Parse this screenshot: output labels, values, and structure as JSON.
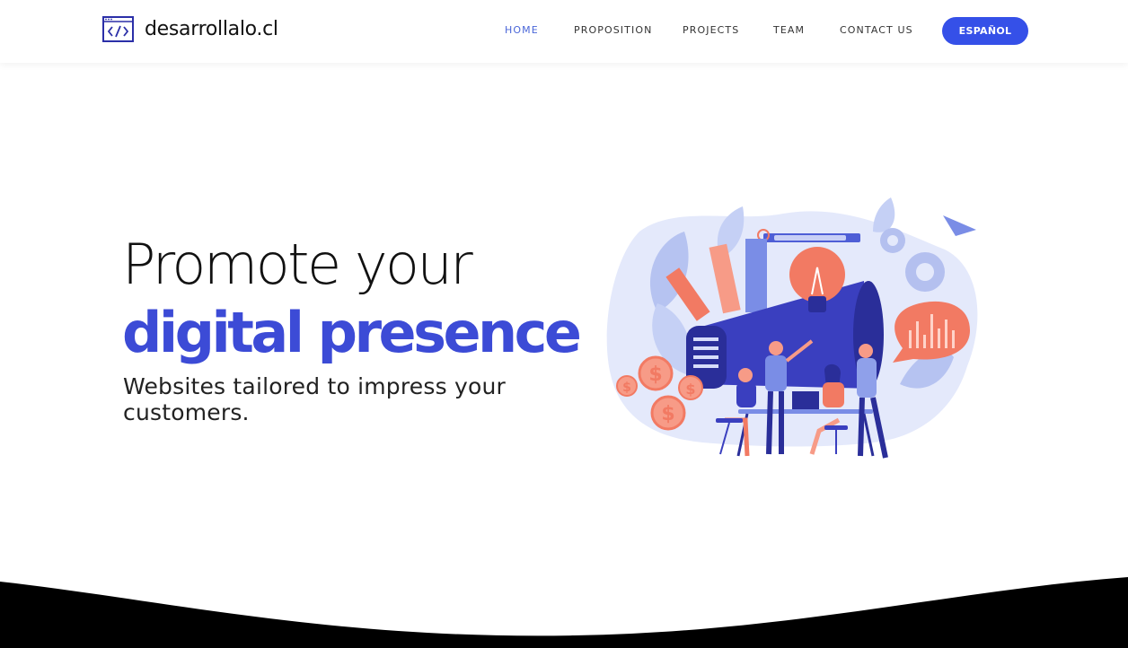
{
  "brand": {
    "name": "desarrollalo.cl"
  },
  "nav": {
    "items": [
      {
        "label": "HOME",
        "active": true
      },
      {
        "label": "PROPOSITION",
        "active": false
      },
      {
        "label": "PROJECTS",
        "active": false
      },
      {
        "label": "TEAM",
        "active": false
      },
      {
        "label": "CONTACT US",
        "active": false
      }
    ],
    "language_button": "ESPAÑOL"
  },
  "hero": {
    "title_line1": "Promote your",
    "title_line2": "digital presence",
    "subtitle": "Websites tailored to impress your customers."
  },
  "colors": {
    "accent": "#3c4bd6",
    "button": "#3550e8",
    "active_link": "#4a66d8",
    "coral": "#f27a63",
    "footer_band": "#000000"
  },
  "icons": [
    "code-window-icon",
    "lightbulb-icon",
    "gear-icon",
    "paper-plane-icon",
    "dollar-coin-icon",
    "megaphone-icon",
    "bar-chart-icon"
  ]
}
